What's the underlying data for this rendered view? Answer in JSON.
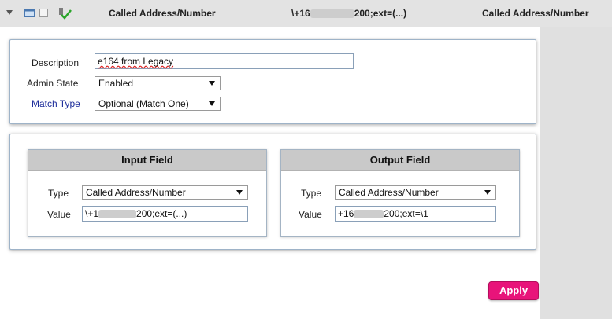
{
  "header": {
    "column_type": "Called Address/Number",
    "match_value_prefix": "\\+16",
    "match_value_suffix": "200;ext=(...)",
    "column_type_right": "Called Address/Number"
  },
  "details": {
    "description_label": "Description",
    "description_value": "e164 from Legacy",
    "admin_state_label": "Admin State",
    "admin_state_value": "Enabled",
    "match_type_label": "Match Type",
    "match_type_value": "Optional (Match One)"
  },
  "input_field": {
    "title": "Input Field",
    "type_label": "Type",
    "type_value": "Called Address/Number",
    "value_label": "Value",
    "value_prefix": "\\+1",
    "value_suffix": "200;ext=(...)"
  },
  "output_field": {
    "title": "Output Field",
    "type_label": "Type",
    "type_value": "Called Address/Number",
    "value_label": "Value",
    "value_prefix": "+16",
    "value_suffix": "200;ext=\\1"
  },
  "actions": {
    "apply_label": "Apply"
  },
  "colors": {
    "apply_bg": "#e8147a",
    "match_type_label": "#1c2c9a",
    "check": "#2aa52a"
  }
}
